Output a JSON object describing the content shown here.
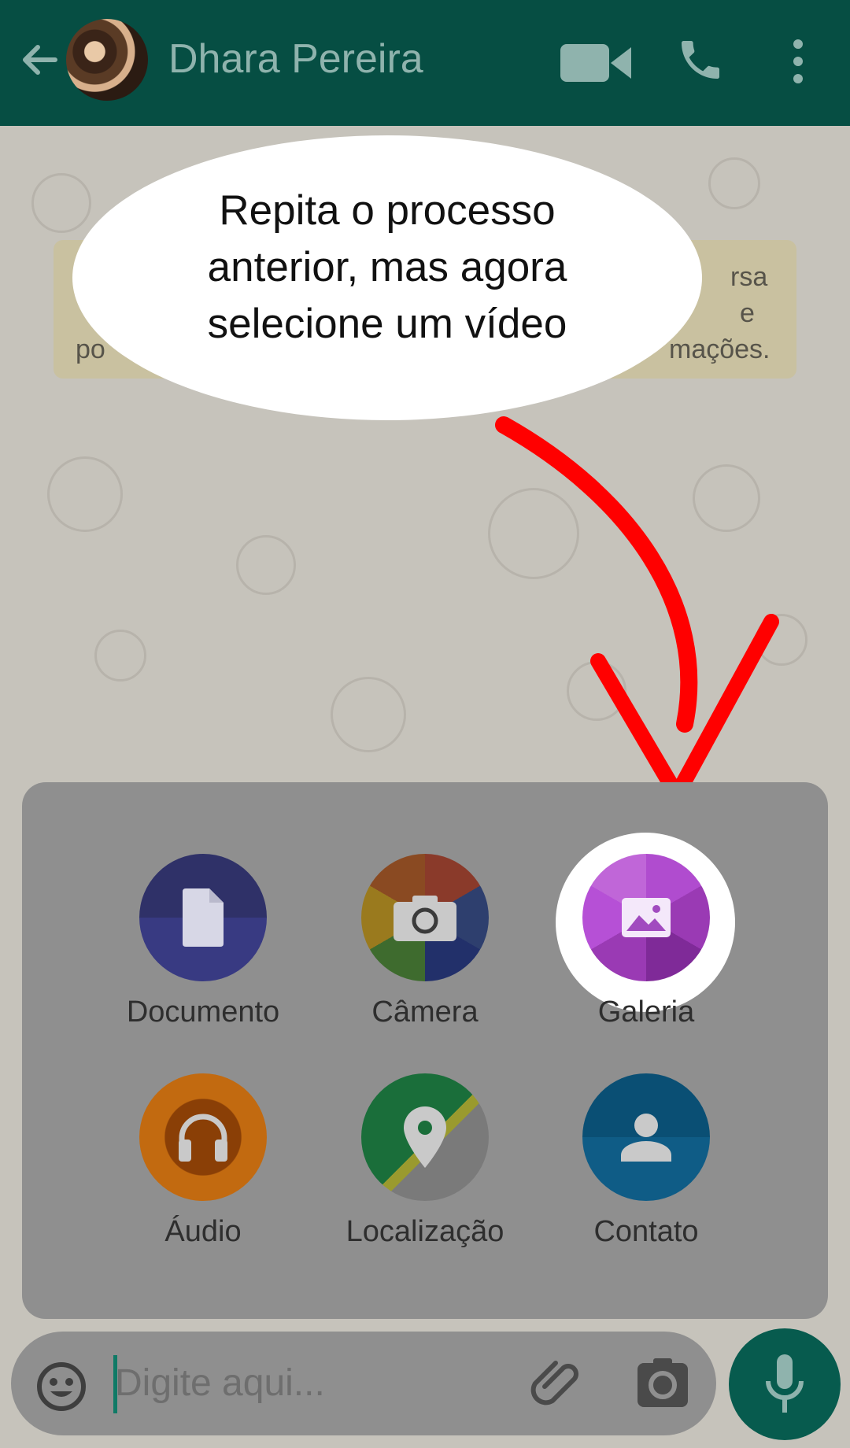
{
  "header": {
    "contact_name": "Dhara Pereira",
    "back_icon": "arrow-left-icon",
    "video_icon": "video-camera-icon",
    "call_icon": "phone-icon",
    "menu_icon": "more-vert-icon",
    "color": "#064e43"
  },
  "encryption_notice": {
    "visible_fragments": [
      "rsa",
      "e",
      "po",
      "mações."
    ]
  },
  "callout": {
    "lines": [
      "Repita o processo",
      "anterior, mas agora",
      "selecione um vídeo"
    ],
    "arrow_color": "#ff0000"
  },
  "attach_menu": {
    "items": [
      {
        "label": "Documento",
        "icon": "document-icon",
        "color": "#383a82"
      },
      {
        "label": "Câmera",
        "icon": "camera-icon",
        "color": "#8a3a2a"
      },
      {
        "label": "Galeria",
        "icon": "gallery-icon",
        "color": "#a040b8",
        "highlighted": true
      },
      {
        "label": "Áudio",
        "icon": "headphones-icon",
        "color": "#c26a10"
      },
      {
        "label": "Localização",
        "icon": "location-pin-icon",
        "color": "#1a6e3a"
      },
      {
        "label": "Contato",
        "icon": "person-icon",
        "color": "#0f5c86"
      }
    ]
  },
  "composer": {
    "placeholder": "Digite aqui...",
    "emoji_icon": "emoji-icon",
    "attach_icon": "paperclip-icon",
    "camera_icon": "camera-icon",
    "mic_icon": "microphone-icon"
  }
}
